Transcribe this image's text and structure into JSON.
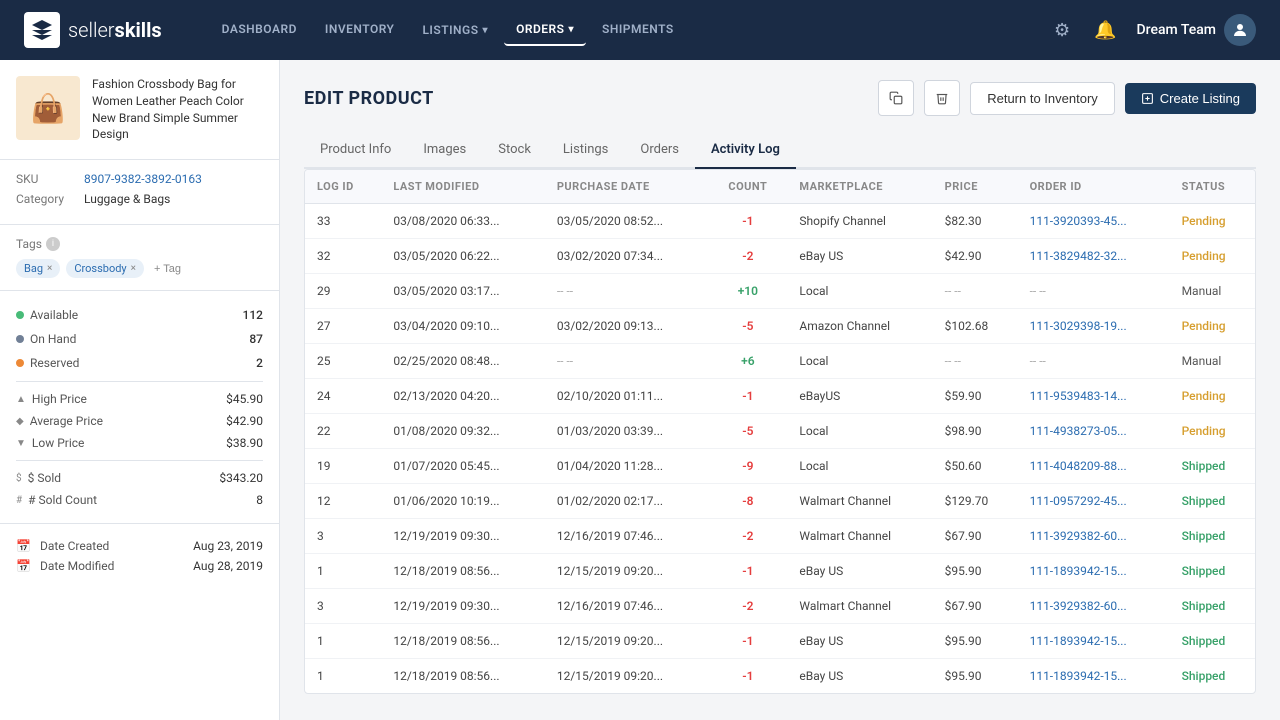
{
  "brand": {
    "seller": "seller",
    "skills": "skills",
    "team_name": "Dream Team"
  },
  "nav": {
    "links": [
      {
        "id": "dashboard",
        "label": "DASHBOARD",
        "active": false,
        "dropdown": false
      },
      {
        "id": "inventory",
        "label": "INVENTORY",
        "active": false,
        "dropdown": false
      },
      {
        "id": "listings",
        "label": "LISTINGS",
        "active": false,
        "dropdown": true
      },
      {
        "id": "orders",
        "label": "ORDERS",
        "active": true,
        "dropdown": true
      },
      {
        "id": "shipments",
        "label": "SHIPMENTS",
        "active": false,
        "dropdown": false
      }
    ]
  },
  "page": {
    "title": "EDIT PRODUCT",
    "return_label": "Return to Inventory",
    "create_label": "Create Listing"
  },
  "tabs": [
    {
      "id": "product-info",
      "label": "Product Info",
      "active": false
    },
    {
      "id": "images",
      "label": "Images",
      "active": false
    },
    {
      "id": "stock",
      "label": "Stock",
      "active": false
    },
    {
      "id": "listings",
      "label": "Listings",
      "active": false
    },
    {
      "id": "orders",
      "label": "Orders",
      "active": false
    },
    {
      "id": "activity-log",
      "label": "Activity Log",
      "active": true
    }
  ],
  "product": {
    "name": "Fashion Crossbody Bag for Women Leather Peach Color New Brand Simple Summer Design",
    "sku_label": "SKU",
    "sku": "8907-9382-3892-0163",
    "category_label": "Category",
    "category": "Luggage & Bags",
    "tags_label": "Tags",
    "tags": [
      "Bag",
      "Crossbody"
    ],
    "add_tag": "+ Tag"
  },
  "inventory": {
    "available_label": "Available",
    "available": "112",
    "onhand_label": "On Hand",
    "onhand": "87",
    "reserved_label": "Reserved",
    "reserved": "2",
    "high_price_label": "High Price",
    "high_price": "$45.90",
    "average_price_label": "Average Price",
    "average_price": "$42.90",
    "low_price_label": "Low Price",
    "low_price": "$38.90",
    "sold_label": "$ Sold",
    "sold": "$343.20",
    "sold_count_label": "# Sold Count",
    "sold_count": "8"
  },
  "dates": {
    "created_label": "Date Created",
    "created": "Aug 23, 2019",
    "modified_label": "Date Modified",
    "modified": "Aug 28, 2019"
  },
  "table": {
    "columns": [
      "LOG ID",
      "LAST MODIFIED",
      "PURCHASE DATE",
      "COUNT",
      "MARKETPLACE",
      "PRICE",
      "ORDER ID",
      "STATUS"
    ],
    "rows": [
      {
        "log_id": "33",
        "last_modified": "03/08/2020 06:33...",
        "purchase_date": "03/05/2020 08:52...",
        "count": "-1",
        "count_type": "neg",
        "marketplace": "Shopify Channel",
        "price": "$82.30",
        "order_id": "111-3920393-45...",
        "order_link": true,
        "status": "Pending",
        "status_type": "pending"
      },
      {
        "log_id": "32",
        "last_modified": "03/05/2020 06:22...",
        "purchase_date": "03/02/2020 07:34...",
        "count": "-2",
        "count_type": "neg",
        "marketplace": "eBay US",
        "price": "$42.90",
        "order_id": "111-3829482-32...",
        "order_link": true,
        "status": "Pending",
        "status_type": "pending"
      },
      {
        "log_id": "29",
        "last_modified": "03/05/2020 03:17...",
        "purchase_date": "-- --",
        "count": "+10",
        "count_type": "pos",
        "marketplace": "Local",
        "price": "-- --",
        "order_id": "-- --",
        "order_link": false,
        "status": "Manual",
        "status_type": "manual"
      },
      {
        "log_id": "27",
        "last_modified": "03/04/2020 09:10...",
        "purchase_date": "03/02/2020 09:13...",
        "count": "-5",
        "count_type": "neg",
        "marketplace": "Amazon Channel",
        "price": "$102.68",
        "order_id": "111-3029398-19...",
        "order_link": true,
        "status": "Pending",
        "status_type": "pending"
      },
      {
        "log_id": "25",
        "last_modified": "02/25/2020 08:48...",
        "purchase_date": "-- --",
        "count": "+6",
        "count_type": "pos",
        "marketplace": "Local",
        "price": "-- --",
        "order_id": "-- --",
        "order_link": false,
        "status": "Manual",
        "status_type": "manual"
      },
      {
        "log_id": "24",
        "last_modified": "02/13/2020 04:20...",
        "purchase_date": "02/10/2020 01:11...",
        "count": "-1",
        "count_type": "neg",
        "marketplace": "eBayUS",
        "price": "$59.90",
        "order_id": "111-9539483-14...",
        "order_link": true,
        "status": "Pending",
        "status_type": "pending"
      },
      {
        "log_id": "22",
        "last_modified": "01/08/2020 09:32...",
        "purchase_date": "01/03/2020 03:39...",
        "count": "-5",
        "count_type": "neg",
        "marketplace": "Local",
        "price": "$98.90",
        "order_id": "111-4938273-05...",
        "order_link": true,
        "status": "Pending",
        "status_type": "pending"
      },
      {
        "log_id": "19",
        "last_modified": "01/07/2020 05:45...",
        "purchase_date": "01/04/2020 11:28...",
        "count": "-9",
        "count_type": "neg",
        "marketplace": "Local",
        "price": "$50.60",
        "order_id": "111-4048209-88...",
        "order_link": true,
        "status": "Shipped",
        "status_type": "shipped"
      },
      {
        "log_id": "12",
        "last_modified": "01/06/2020 10:19...",
        "purchase_date": "01/02/2020 02:17...",
        "count": "-8",
        "count_type": "neg",
        "marketplace": "Walmart Channel",
        "price": "$129.70",
        "order_id": "111-0957292-45...",
        "order_link": true,
        "status": "Shipped",
        "status_type": "shipped"
      },
      {
        "log_id": "3",
        "last_modified": "12/19/2019 09:30...",
        "purchase_date": "12/16/2019 07:46...",
        "count": "-2",
        "count_type": "neg",
        "marketplace": "Walmart Channel",
        "price": "$67.90",
        "order_id": "111-3929382-60...",
        "order_link": true,
        "status": "Shipped",
        "status_type": "shipped"
      },
      {
        "log_id": "1",
        "last_modified": "12/18/2019 08:56...",
        "purchase_date": "12/15/2019 09:20...",
        "count": "-1",
        "count_type": "neg",
        "marketplace": "eBay US",
        "price": "$95.90",
        "order_id": "111-1893942-15...",
        "order_link": true,
        "status": "Shipped",
        "status_type": "shipped"
      },
      {
        "log_id": "3",
        "last_modified": "12/19/2019 09:30...",
        "purchase_date": "12/16/2019 07:46...",
        "count": "-2",
        "count_type": "neg",
        "marketplace": "Walmart Channel",
        "price": "$67.90",
        "order_id": "111-3929382-60...",
        "order_link": true,
        "status": "Shipped",
        "status_type": "shipped"
      },
      {
        "log_id": "1",
        "last_modified": "12/18/2019 08:56...",
        "purchase_date": "12/15/2019 09:20...",
        "count": "-1",
        "count_type": "neg",
        "marketplace": "eBay US",
        "price": "$95.90",
        "order_id": "111-1893942-15...",
        "order_link": true,
        "status": "Shipped",
        "status_type": "shipped"
      },
      {
        "log_id": "1",
        "last_modified": "12/18/2019 08:56...",
        "purchase_date": "12/15/2019 09:20...",
        "count": "-1",
        "count_type": "neg",
        "marketplace": "eBay US",
        "price": "$95.90",
        "order_id": "111-1893942-15...",
        "order_link": true,
        "status": "Shipped",
        "status_type": "shipped"
      }
    ]
  }
}
